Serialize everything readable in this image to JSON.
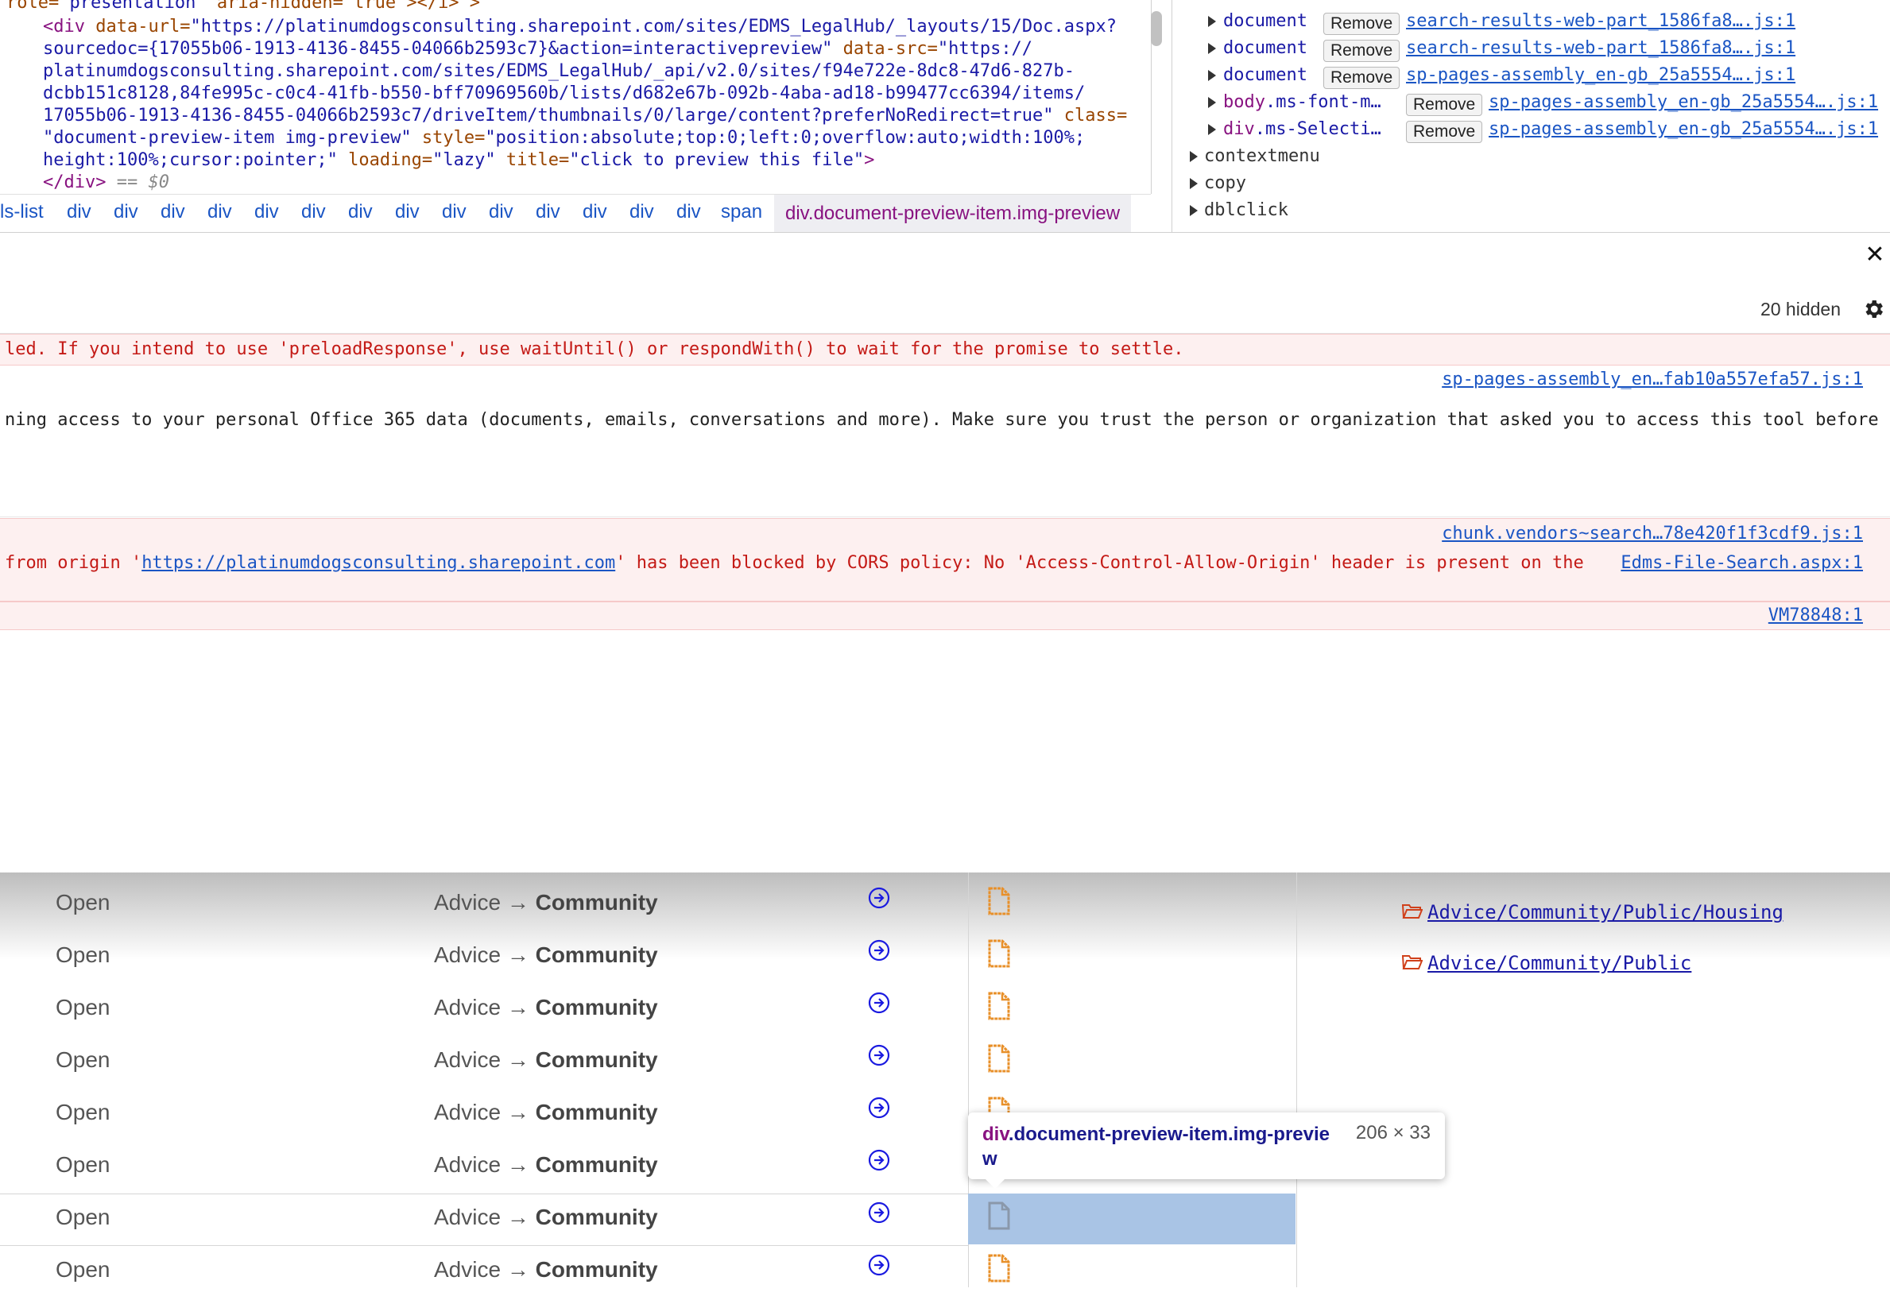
{
  "elements": {
    "line0": {
      "tag_open": "role=",
      "val": "\"presentation\"",
      "rest": " aria-hidden=\"true\"></i>\">"
    },
    "line1": {
      "tag": "<div ",
      "attr1": "data-url=",
      "val1": "\"https://platinumdogsconsulting.sharepoint.com/sites/EDMS_LegalHub/_layouts/15/Doc.aspx?"
    },
    "line2": {
      "val": "sourcedoc={17055b06-1913-4136-8455-04066b2593c7}&action=interactivepreview\"",
      "attr": " data-src=",
      "val2": "\"https://"
    },
    "line3": {
      "val": "platinumdogsconsulting.sharepoint.com/sites/EDMS_LegalHub/_api/v2.0/sites/f94e722e-8dc8-47d6-827b-"
    },
    "line4": {
      "val": "dcbb151c8128,84fe995c-c0c4-41fb-b550-bff70969560b/lists/d682e67b-092b-4aba-ad18-b99477cc6394/items/"
    },
    "line5": {
      "val": "17055b06-1913-4136-8455-04066b2593c7/driveItem/thumbnails/0/large/content?preferNoRedirect=true\"",
      "attr": " class="
    },
    "line6": {
      "val": "\"document-preview-item img-preview\"",
      "attr": " style=",
      "val2": "\"position:absolute;top:0;left:0;overflow:auto;width:100%;"
    },
    "line7": {
      "val": "height:100%;cursor:pointer;\"",
      "attr": " loading=",
      "val2": "\"lazy\"",
      "attr2": " title=",
      "val3": "\"click to preview this file\"",
      "tail": ">"
    },
    "line8": {
      "tag": "</div>",
      "dim": " == $0"
    }
  },
  "breadcrumb": {
    "items": [
      "ls-list",
      "div",
      "div",
      "div",
      "div",
      "div",
      "div",
      "div",
      "div",
      "div",
      "div",
      "div",
      "div",
      "div",
      "div",
      "span"
    ],
    "active": "div.document-preview-item.img-preview"
  },
  "listeners": {
    "rows": [
      {
        "node_prefix": "",
        "node_name": "document",
        "remove": "Remove",
        "link": "search-results-web-part_1586fa8….js:1"
      },
      {
        "node_prefix": "",
        "node_name": "document",
        "remove": "Remove",
        "link": "search-results-web-part_1586fa8….js:1"
      },
      {
        "node_prefix": "",
        "node_name": "document",
        "remove": "Remove",
        "link": "sp-pages-assembly_en-gb_25a5554….js:1"
      },
      {
        "node_prefix": "body",
        "node_name": ".ms-font-m…",
        "remove": "Remove",
        "link": "sp-pages-assembly_en-gb_25a5554….js:1"
      },
      {
        "node_prefix": "div",
        "node_name": ".ms-Selecti…",
        "remove": "Remove",
        "link": "sp-pages-assembly_en-gb_25a5554….js:1"
      }
    ],
    "groups": [
      "contextmenu",
      "copy",
      "dblclick"
    ]
  },
  "console": {
    "hidden_count": "20 hidden",
    "messages": [
      {
        "text": "led. If you intend to use 'preloadResponse', use waitUntil() or respondWith() to wait for the promise to settle.",
        "level": "error",
        "source": ""
      },
      {
        "text": "",
        "level": "info",
        "source": "sp-pages-assembly_en…fab10a557efa57.js:1"
      },
      {
        "text": "ning access to your personal Office 365 data (documents, emails, conversations and more). Make sure you trust the person or organization that asked you to access this tool before",
        "level": "info",
        "source": ""
      },
      {
        "text": "",
        "level": "error",
        "source": "chunk.vendors~search…78e420f1f3cdf9.js:1"
      },
      {
        "text_before": " from origin '",
        "text_link": "https://platinumdogsconsulting.sharepoint.com",
        "text_after": "' has been blocked by CORS policy: No 'Access-Control-Allow-Origin' header is present on the",
        "level": "error",
        "source": "Edms-File-Search.aspx:1"
      },
      {
        "text": "",
        "level": "error",
        "source": "VM78848:1"
      }
    ]
  },
  "page": {
    "rows": [
      {
        "status": "Open",
        "path_prefix": "Advice → ",
        "path_bold": "Community"
      },
      {
        "status": "Open",
        "path_prefix": "Advice → ",
        "path_bold": "Community"
      },
      {
        "status": "Open",
        "path_prefix": "Advice → ",
        "path_bold": "Community"
      },
      {
        "status": "Open",
        "path_prefix": "Advice → ",
        "path_bold": "Community"
      },
      {
        "status": "Open",
        "path_prefix": "Advice → ",
        "path_bold": "Community"
      },
      {
        "status": "Open",
        "path_prefix": "Advice → ",
        "path_bold": "Community"
      },
      {
        "status": "Open",
        "path_prefix": "Advice → ",
        "path_bold": "Community"
      },
      {
        "status": "Open",
        "path_prefix": "Advice → ",
        "path_bold": "Community"
      }
    ],
    "folders": [
      "Advice/Community/Public/Housing",
      "Advice/Community/Public"
    ]
  },
  "tooltip": {
    "tag": "div",
    "classes": ".document-preview-item.img-preview",
    "size": "206 × 33"
  },
  "colors": {
    "error_bg": "#fdf0f0",
    "error_text": "#c41a16",
    "link": "#1a55c4",
    "highlight": "#a9c4e5",
    "doc_icon": "#e8902a"
  }
}
